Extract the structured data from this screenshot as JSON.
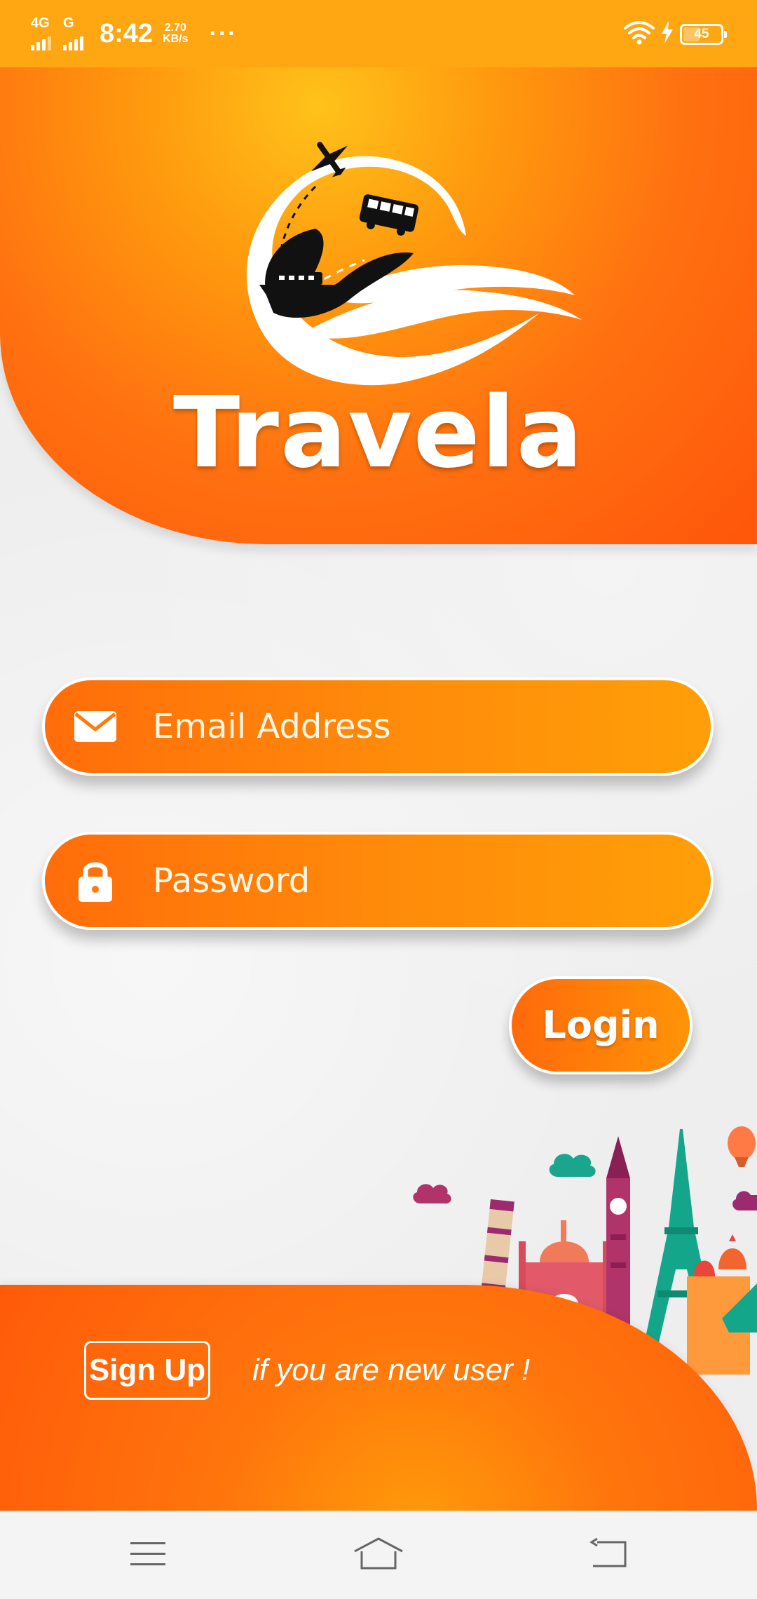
{
  "status_bar": {
    "network_1": "4G",
    "network_2": "G",
    "time": "8:42",
    "speed_value": "2.70",
    "speed_unit": "KB/s",
    "more": "···",
    "battery": "45",
    "battery_level": 0.45
  },
  "app": {
    "brand_name": "Travela"
  },
  "login_form": {
    "email_placeholder": "Email Address",
    "password_placeholder": "Password",
    "login_label": "Login"
  },
  "footer": {
    "signup_label": "Sign Up",
    "signup_note": "if you are new user !"
  },
  "icons": {
    "email": "envelope-icon",
    "password": "lock-icon",
    "nav_menu": "menu-icon",
    "nav_home": "home-icon",
    "nav_back": "back-icon"
  },
  "colors": {
    "primary_orange": "#ff6d0a",
    "accent_orange": "#ffa712",
    "white": "#ffffff"
  }
}
